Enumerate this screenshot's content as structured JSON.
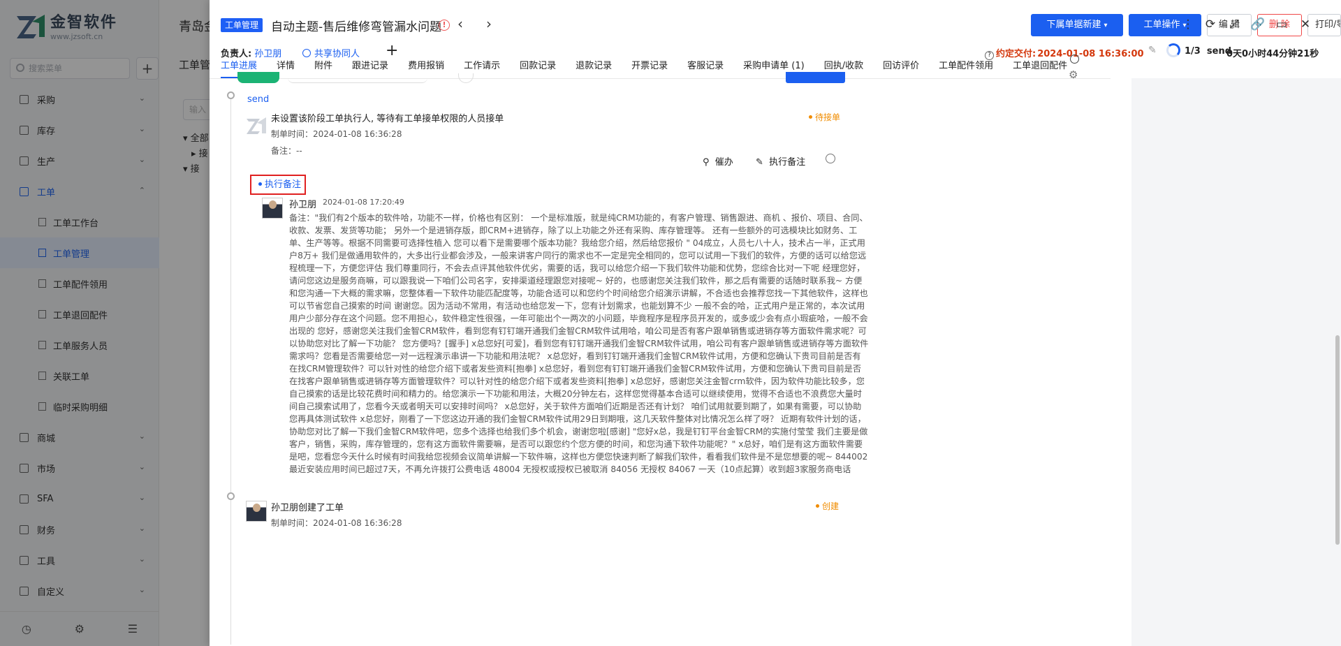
{
  "brand": {
    "name": "金智软件",
    "url": "www.jzsoft.cn"
  },
  "sidebar": {
    "search_placeholder": "搜索菜单",
    "items": [
      {
        "label": "采购",
        "icon": "cart-icon"
      },
      {
        "label": "库存",
        "icon": "warehouse-icon"
      },
      {
        "label": "生产",
        "icon": "factory-icon"
      },
      {
        "label": "工单",
        "icon": "document-icon",
        "expanded": true
      }
    ],
    "subitems": [
      {
        "label": "工单工作台",
        "active": false
      },
      {
        "label": "工单管理",
        "active": true
      },
      {
        "label": "工单配件领用",
        "active": false
      },
      {
        "label": "工单退回配件",
        "active": false
      },
      {
        "label": "工单服务人员",
        "active": false
      },
      {
        "label": "关联工单",
        "active": false
      },
      {
        "label": "临时采购明细",
        "active": false
      }
    ],
    "items_after": [
      {
        "label": "商城",
        "icon": "shop-icon"
      },
      {
        "label": "市场",
        "icon": "market-icon"
      },
      {
        "label": "SFA",
        "icon": "sfa-icon"
      },
      {
        "label": "财务",
        "icon": "finance-icon"
      },
      {
        "label": "工具",
        "icon": "tool-icon"
      },
      {
        "label": "自定义",
        "icon": "custom-icon"
      }
    ]
  },
  "background": {
    "title1": "青岛金",
    "title2": "工单管",
    "input_placeholder": "输入",
    "tree": [
      "全部",
      "接",
      "接"
    ]
  },
  "drawer": {
    "badge": "工单管理",
    "title": "自动主题-售后维修弯管漏水问题",
    "buttons": {
      "sub_new": "下属单据新建",
      "order_ops": "工单操作",
      "edit": "编 辑",
      "delete": "删 除",
      "print": "打印/导出"
    },
    "owner_label": "负责人:",
    "owner_name": "孙卫朋",
    "share_label": "共享协同人",
    "due_label": "约定交付:",
    "due_value": "2024-01-08 16:36:00",
    "progress": "1/3",
    "stage": "send",
    "elapsed": "0天0小时44分钟21秒",
    "tabs": [
      "工单进展",
      "详情",
      "附件",
      "跟进记录",
      "费用报销",
      "工作请示",
      "回款记录",
      "退款记录",
      "开票记录",
      "客服记录",
      "采购申请单 (1)",
      "回执/收款",
      "回访评价",
      "工单配件领用",
      "工单退回配件"
    ],
    "active_tab": 0
  },
  "timeline": {
    "stage_name": "send",
    "entry1": {
      "title": "未设置该阶段工单执行人, 等待有工单接单权限的人员接单",
      "time": "制单时间：2024-01-08 16:36:28",
      "note": "备注：--",
      "status": "待接单",
      "urge": "催办",
      "add_note": "执行备注"
    },
    "note_tag": "执行备注",
    "note": {
      "author": "孙卫朋",
      "time": "2024-01-08 17:20:49",
      "body": "备注：\"我们有2个版本的软件哈，功能不一样，价格也有区别： 一个是标准版，就是纯CRM功能的，有客户管理、销售跟进、商机 、报价、项目、合同、收款、发票、发货等功能； 另外一个是进销存版，即CRM+进销存，除了以上功能之外还有采购、库存管理等。 还有一些额外的可选模块比如财务、工单、生产等等。根据不同需要可选择性植入 您可以看下是需要哪个版本功能？我给您介绍，然后给您报价 \" 04成立，人员七八十人，技术占一半，正式用户8万+ 我们是做通用软件的，大多出行业都会涉及，一般来讲客户同行的需求也不一定是完全相同的，您可以试用一下我们的软件，方便的话可以给您远程梳理一下，方便您评估 我们尊重同行，不会去点评其他软件优劣，需要的话，我可以给您介绍一下我们软件功能和优势，您综合比对一下呢 经理您好，请问您这边是服务商嘛，可以跟我说一下咱们公司名字，安排渠道经理跟您对接呢~ 好的，也感谢您关注我们软件，那之后有需要的话随时联系我~ 方便和您沟通一下大概的需求嘛，您整体看一下软件功能匹配度等，功能合适可以和您约个时间给您介绍演示讲解，不合适也会推荐您找一下其他软件，这样也可以节省您自己摸索的时间 谢谢您。因为活动不常用，有活动也给您发一下，您有计划需求，也能划算不少 一般不会的哈，正式用户是正常的，本次试用用户少部分存在这个问题。您不用担心，软件稳定性很强，一年可能出个一两次的小问题，毕竟程序是程序员开发的，或多或少会有点小瑕疵哈，一般不会出现的 您好，感谢您关注我们金智CRM软件，看到您有钉钉端开通我们金智CRM软件试用哈，咱公司是否有客户跟单销售或进销存等方面软件需求呢？可以协助您对比了解一下功能？ 您方便吗？[握手] x总您好[可爱]，看到您有钉钉端开通我们金智CRM软件试用，咱公司有客户跟单销售或进销存等方面软件需求吗？您看是否需要给您一对一远程演示串讲一下功能和用法呢？ x总您好，看到钉钉端开通我们金智CRM软件试用，方便和您确认下贵司目前是否有在找CRM管理软件？可以针对性的给您介绍下或者发些资料[抱拳] x总您好，看到您有钉钉端开通我们金智CRM软件试用，方便和您确认下贵司目前是否在找客户跟单销售或进销存等方面管理软件？可以针对性的给您介绍下或者发些资料[抱拳] x总您好，感谢您关注金智crm软件，因为软件功能比较多，您自己摸索的话是比较花费时间和精力的。给您演示一下功能和用法，大概20分钟左右，这样您觉得基本合适可以继续使用，觉得不合适也不浪费您大量时间自己摸索试用了，您看今天或者明天可以安排时间吗？ x总您好，关于软件方面咱们近期是否还有计划？ 咱们试用就要到期了，如果有需要，可以协助您再具体测试软件 x总您好，刚看了一下您这边开通的我们金智CRM软件试用29日到期哦，这几天软件整体对比情况怎么样了呀？ 近期有软件计划的话，协助您对比了解一下我们金智CRM软件吧，您多个选择也给我们多个机会，谢谢您啦[感谢] \"您好x总，我是钉钉平台金智CRM的实施付莹莹 我们主要是做客户，销售，采购，库存管理的，您有这方面软件需要嘛，是否可以跟您约个您方便的时间，和您沟通下软件功能呢？\" x总好，咱们是有这方面软件需要是吧，您看您今天什么时候有时间我给您视频会议简单讲解一下软件嘛，这样也方便您快速判断了解我们软件，看看我们软件是不是您想要的呢~ 844002最近安装应用时间已超过7天，不再允许拨打公费电话 48004 无授权或授权已被取消 84056 无授权 84067 一天（10点起算）收到超3家服务商电话"
    },
    "entry3": {
      "title": "孙卫朋创建了工单",
      "time": "制单时间：2024-01-08 16:36:28",
      "status": "创建"
    }
  },
  "colors": {
    "primary": "#1b5ff0",
    "danger": "#f04747",
    "warning": "#f08c00",
    "highlight_border": "#e02020"
  }
}
